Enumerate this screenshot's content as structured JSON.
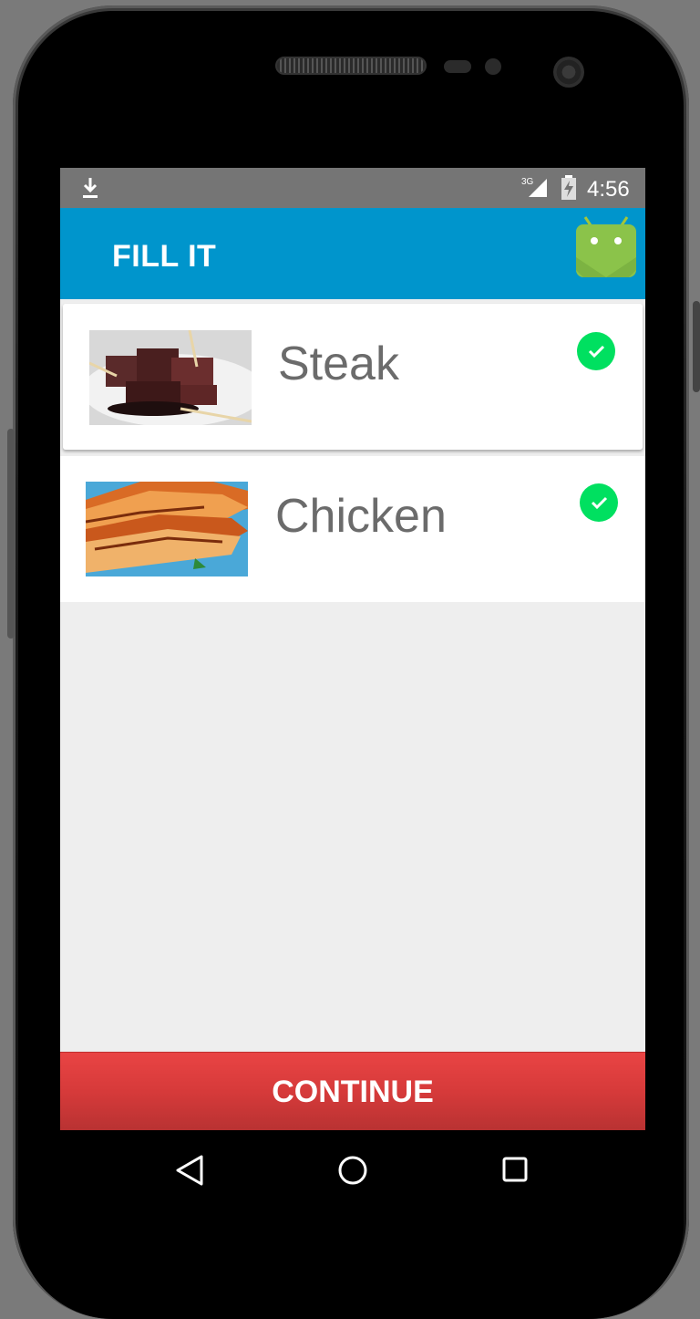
{
  "status_bar": {
    "time": "4:56",
    "network": "3G",
    "icons": [
      "download-icon",
      "signal-icon",
      "battery-icon"
    ]
  },
  "app_bar": {
    "title": "FILL IT",
    "logo": "android-logo",
    "color": "#0095cc"
  },
  "list": {
    "items": [
      {
        "label": "Steak",
        "image": "steak-photo",
        "checked": true
      },
      {
        "label": "Chicken",
        "image": "chicken-photo",
        "checked": true
      }
    ]
  },
  "continue_button": {
    "label": "CONTINUE",
    "color": "#d63a3a"
  },
  "nav_bar": {
    "icons": [
      "back-icon",
      "home-icon",
      "recents-icon"
    ]
  },
  "colors": {
    "check": "#00e060",
    "background": "#eeeeee"
  }
}
